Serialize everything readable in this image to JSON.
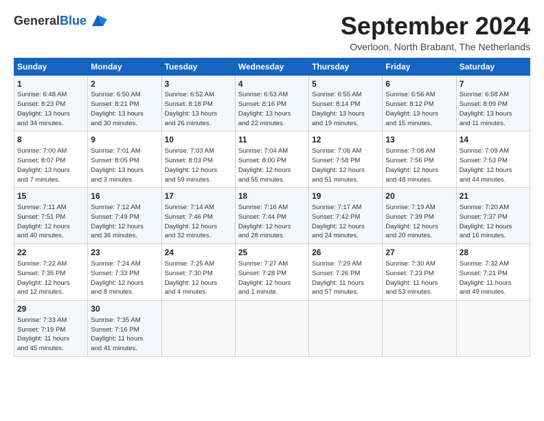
{
  "header": {
    "logo_text_general": "General",
    "logo_text_blue": "Blue",
    "month_title": "September 2024",
    "subtitle": "Overloon, North Brabant, The Netherlands"
  },
  "weekdays": [
    "Sunday",
    "Monday",
    "Tuesday",
    "Wednesday",
    "Thursday",
    "Friday",
    "Saturday"
  ],
  "weeks": [
    [
      {
        "day": "1",
        "info": "Sunrise: 6:48 AM\nSunset: 8:23 PM\nDaylight: 13 hours\nand 34 minutes."
      },
      {
        "day": "2",
        "info": "Sunrise: 6:50 AM\nSunset: 8:21 PM\nDaylight: 13 hours\nand 30 minutes."
      },
      {
        "day": "3",
        "info": "Sunrise: 6:52 AM\nSunset: 8:18 PM\nDaylight: 13 hours\nand 26 minutes."
      },
      {
        "day": "4",
        "info": "Sunrise: 6:53 AM\nSunset: 8:16 PM\nDaylight: 13 hours\nand 22 minutes."
      },
      {
        "day": "5",
        "info": "Sunrise: 6:55 AM\nSunset: 8:14 PM\nDaylight: 13 hours\nand 19 minutes."
      },
      {
        "day": "6",
        "info": "Sunrise: 6:56 AM\nSunset: 8:12 PM\nDaylight: 13 hours\nand 15 minutes."
      },
      {
        "day": "7",
        "info": "Sunrise: 6:58 AM\nSunset: 8:09 PM\nDaylight: 13 hours\nand 11 minutes."
      }
    ],
    [
      {
        "day": "8",
        "info": "Sunrise: 7:00 AM\nSunset: 8:07 PM\nDaylight: 13 hours\nand 7 minutes."
      },
      {
        "day": "9",
        "info": "Sunrise: 7:01 AM\nSunset: 8:05 PM\nDaylight: 13 hours\nand 3 minutes."
      },
      {
        "day": "10",
        "info": "Sunrise: 7:03 AM\nSunset: 8:03 PM\nDaylight: 12 hours\nand 59 minutes."
      },
      {
        "day": "11",
        "info": "Sunrise: 7:04 AM\nSunset: 8:00 PM\nDaylight: 12 hours\nand 55 minutes."
      },
      {
        "day": "12",
        "info": "Sunrise: 7:06 AM\nSunset: 7:58 PM\nDaylight: 12 hours\nand 51 minutes."
      },
      {
        "day": "13",
        "info": "Sunrise: 7:08 AM\nSunset: 7:56 PM\nDaylight: 12 hours\nand 48 minutes."
      },
      {
        "day": "14",
        "info": "Sunrise: 7:09 AM\nSunset: 7:53 PM\nDaylight: 12 hours\nand 44 minutes."
      }
    ],
    [
      {
        "day": "15",
        "info": "Sunrise: 7:11 AM\nSunset: 7:51 PM\nDaylight: 12 hours\nand 40 minutes."
      },
      {
        "day": "16",
        "info": "Sunrise: 7:12 AM\nSunset: 7:49 PM\nDaylight: 12 hours\nand 36 minutes."
      },
      {
        "day": "17",
        "info": "Sunrise: 7:14 AM\nSunset: 7:46 PM\nDaylight: 12 hours\nand 32 minutes."
      },
      {
        "day": "18",
        "info": "Sunrise: 7:16 AM\nSunset: 7:44 PM\nDaylight: 12 hours\nand 28 minutes."
      },
      {
        "day": "19",
        "info": "Sunrise: 7:17 AM\nSunset: 7:42 PM\nDaylight: 12 hours\nand 24 minutes."
      },
      {
        "day": "20",
        "info": "Sunrise: 7:19 AM\nSunset: 7:39 PM\nDaylight: 12 hours\nand 20 minutes."
      },
      {
        "day": "21",
        "info": "Sunrise: 7:20 AM\nSunset: 7:37 PM\nDaylight: 12 hours\nand 16 minutes."
      }
    ],
    [
      {
        "day": "22",
        "info": "Sunrise: 7:22 AM\nSunset: 7:35 PM\nDaylight: 12 hours\nand 12 minutes."
      },
      {
        "day": "23",
        "info": "Sunrise: 7:24 AM\nSunset: 7:33 PM\nDaylight: 12 hours\nand 8 minutes."
      },
      {
        "day": "24",
        "info": "Sunrise: 7:25 AM\nSunset: 7:30 PM\nDaylight: 12 hours\nand 4 minutes."
      },
      {
        "day": "25",
        "info": "Sunrise: 7:27 AM\nSunset: 7:28 PM\nDaylight: 12 hours\nand 1 minute."
      },
      {
        "day": "26",
        "info": "Sunrise: 7:29 AM\nSunset: 7:26 PM\nDaylight: 11 hours\nand 57 minutes."
      },
      {
        "day": "27",
        "info": "Sunrise: 7:30 AM\nSunset: 7:23 PM\nDaylight: 11 hours\nand 53 minutes."
      },
      {
        "day": "28",
        "info": "Sunrise: 7:32 AM\nSunset: 7:21 PM\nDaylight: 11 hours\nand 49 minutes."
      }
    ],
    [
      {
        "day": "29",
        "info": "Sunrise: 7:33 AM\nSunset: 7:19 PM\nDaylight: 11 hours\nand 45 minutes."
      },
      {
        "day": "30",
        "info": "Sunrise: 7:35 AM\nSunset: 7:16 PM\nDaylight: 11 hours\nand 41 minutes."
      },
      {
        "day": "",
        "info": ""
      },
      {
        "day": "",
        "info": ""
      },
      {
        "day": "",
        "info": ""
      },
      {
        "day": "",
        "info": ""
      },
      {
        "day": "",
        "info": ""
      }
    ]
  ]
}
